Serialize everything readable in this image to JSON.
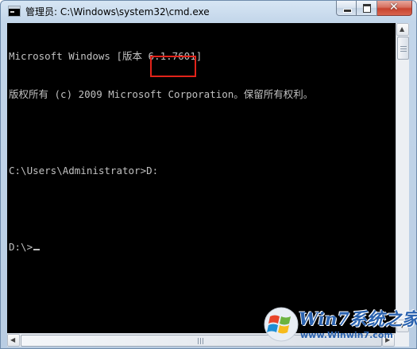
{
  "window": {
    "title": "管理员: C:\\Windows\\system32\\cmd.exe",
    "icon": "cmd-icon",
    "controls": {
      "minimize_icon": "minimize-icon",
      "maximize_icon": "maximize-icon",
      "close_icon": "close-icon",
      "close_glyph": "✕"
    }
  },
  "console": {
    "lines": [
      "Microsoft Windows [版本 6.1.7601]",
      "版权所有 (c) 2009 Microsoft Corporation。保留所有权利。",
      "",
      "C:\\Users\\Administrator>D:",
      "",
      "D:\\>"
    ],
    "text_color": "#c0c0c0",
    "background": "#000000",
    "highlight_color": "#e2231a"
  },
  "watermark": {
    "title": "Win7系统之家",
    "url": "www.Winwin7.com"
  }
}
